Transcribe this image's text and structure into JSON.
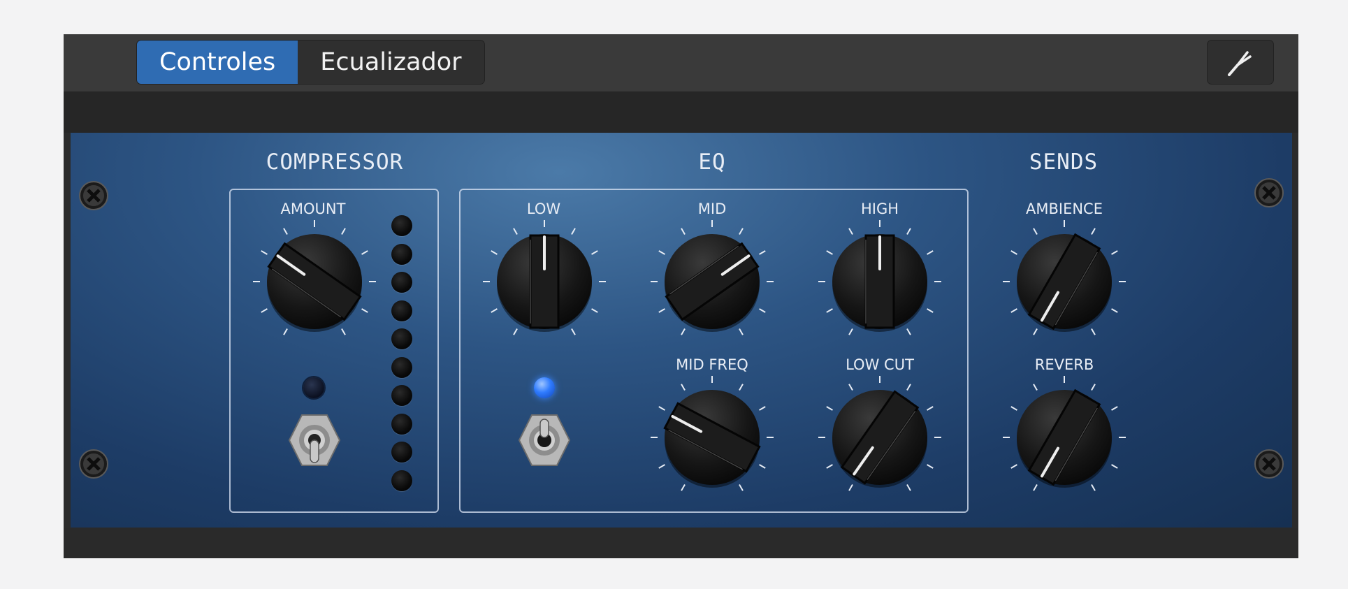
{
  "tabs": {
    "controles": "Controles",
    "ecualizador": "Ecualizador",
    "active": "Controles"
  },
  "toolbar": {
    "tuner_icon": "tuning-fork-icon"
  },
  "sections": {
    "compressor": "COMPRESSOR",
    "eq": "EQ",
    "sends": "SENDS"
  },
  "knobs": {
    "amount": "AMOUNT",
    "low": "LOW",
    "mid": "MID",
    "high": "HIGH",
    "mid_freq": "MID FREQ",
    "low_cut": "LOW CUT",
    "ambience": "AMBIENCE",
    "reverb": "REVERB"
  },
  "meter": {
    "led_count": 10,
    "lit": 0
  },
  "indicators": {
    "compressor_led": "off",
    "eq_led": "on"
  },
  "colors": {
    "accent": "#2f6cb3",
    "panel": "#2d5584",
    "led_on": "#2f7bff"
  }
}
